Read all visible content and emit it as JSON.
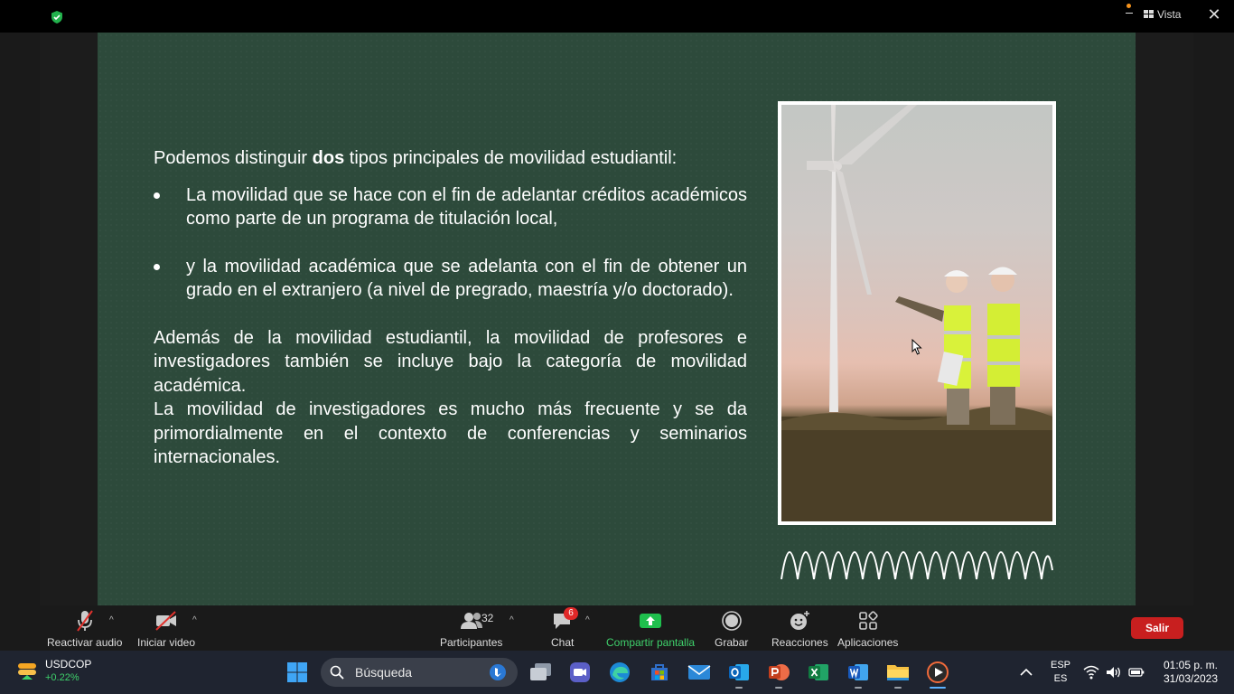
{
  "window": {
    "view_label": "Vista",
    "close_glyph": "✕"
  },
  "slide": {
    "intro_pre": "Podemos distinguir ",
    "intro_bold": "dos",
    "intro_post": " tipos principales de movilidad estudiantil:",
    "bullets": [
      "La movilidad que se hace con el fin de adelantar créditos académicos como parte de un programa de titulación local,",
      "y la movilidad académica que se adelanta con el fin de obtener un grado en el extranjero (a nivel de pregrado, maestría y/o doctorado)."
    ],
    "para1": "Además de la movilidad estudiantil, la movilidad de profesores e investigadores también se incluye bajo la categoría de movilidad académica.",
    "para2": "La movilidad de investigadores es mucho más frecuente y se da primordialmente en el contexto de conferencias y seminarios internacionales."
  },
  "toolbar": {
    "audio_label": "Reactivar audio",
    "video_label": "Iniciar video",
    "participants_label": "Participantes",
    "participants_count": "32",
    "chat_label": "Chat",
    "chat_badge": "6",
    "share_label": "Compartir pantalla",
    "record_label": "Grabar",
    "reactions_label": "Reacciones",
    "apps_label": "Aplicaciones",
    "leave_label": "Salir"
  },
  "taskbar": {
    "stock_name": "USDCOP",
    "stock_change": "+0.22%",
    "search_placeholder": "Búsqueda",
    "lang_top": "ESP",
    "lang_bottom": "ES",
    "time": "01:05 p. m.",
    "date": "31/03/2023"
  },
  "colors": {
    "slide_bg": "#2d4a3b",
    "share_green": "#1fbf4d",
    "leave_red": "#c81f1f",
    "accent_orange": "#f7941d"
  }
}
